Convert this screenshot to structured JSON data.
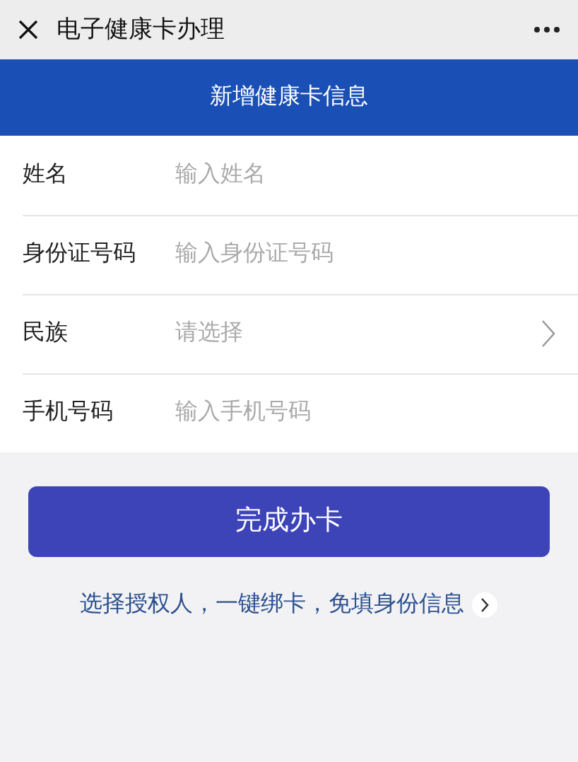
{
  "window": {
    "title": "电子健康卡办理"
  },
  "header": {
    "title": "新增健康卡信息"
  },
  "fields": [
    {
      "kind": "input",
      "label": "姓名",
      "placeholder": "输入姓名"
    },
    {
      "kind": "input",
      "label": "身份证号码",
      "placeholder": "输入身份证号码"
    },
    {
      "kind": "select",
      "label": "民族",
      "placeholder": "请选择"
    },
    {
      "kind": "input",
      "label": "手机号码",
      "placeholder": "输入手机号码"
    }
  ],
  "submit_button": "完成办卡",
  "link": "选择授权人，一键绑卡，免填身份信息"
}
